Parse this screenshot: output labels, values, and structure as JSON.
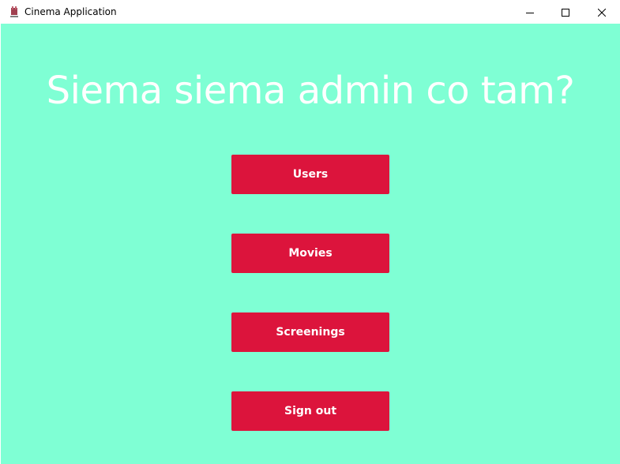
{
  "window": {
    "title": "Cinema Application",
    "icon": "cinema-app-icon",
    "controls": {
      "minimize_icon": "minimize-icon",
      "maximize_icon": "maximize-icon",
      "close_icon": "close-icon"
    }
  },
  "main": {
    "heading": "Siema siema admin co tam?",
    "buttons": [
      {
        "label": "Users"
      },
      {
        "label": "Movies"
      },
      {
        "label": "Screenings"
      },
      {
        "label": "Sign out"
      }
    ]
  },
  "colors": {
    "background": "#7fffd4",
    "button": "#dc143c",
    "heading_text": "#ffffff",
    "button_text": "#ffffff"
  }
}
